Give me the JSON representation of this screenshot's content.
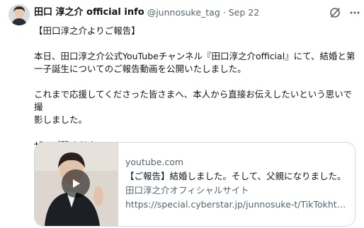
{
  "tweet": {
    "author_name": "田口 淳之介 official info",
    "handle": "@junnosuke_tag",
    "separator": "·",
    "date": "Sep 22",
    "text": "【田口淳之介よりご報告】\n\n本日、田口淳之介公式YouTubeチャンネル『田口淳之介official』にて、結婚と第\n一子誕生についてのご報告動画を公開いたしました。\n\nこれまで応援してくださった皆さまへ、本人から直接お伝えしたいという思いで撮\n影しました。\n\nぜひご覧ください。"
  },
  "card": {
    "domain": "youtube.com",
    "title": "【ご報告】結婚しました。そして、父親になりました。",
    "description": "田口淳之介オフィシャルサイト",
    "url": "https://special.cyberstar.jp/junnosuke-t/TikTokht…"
  },
  "icons": {
    "avatar": "avatar-photo",
    "grok": "grok-icon",
    "more": "more-icon",
    "play": "play-icon"
  },
  "colors": {
    "text": "#0f1419",
    "secondary": "#536471",
    "border": "#cfd9de",
    "background": "#ffffff"
  }
}
